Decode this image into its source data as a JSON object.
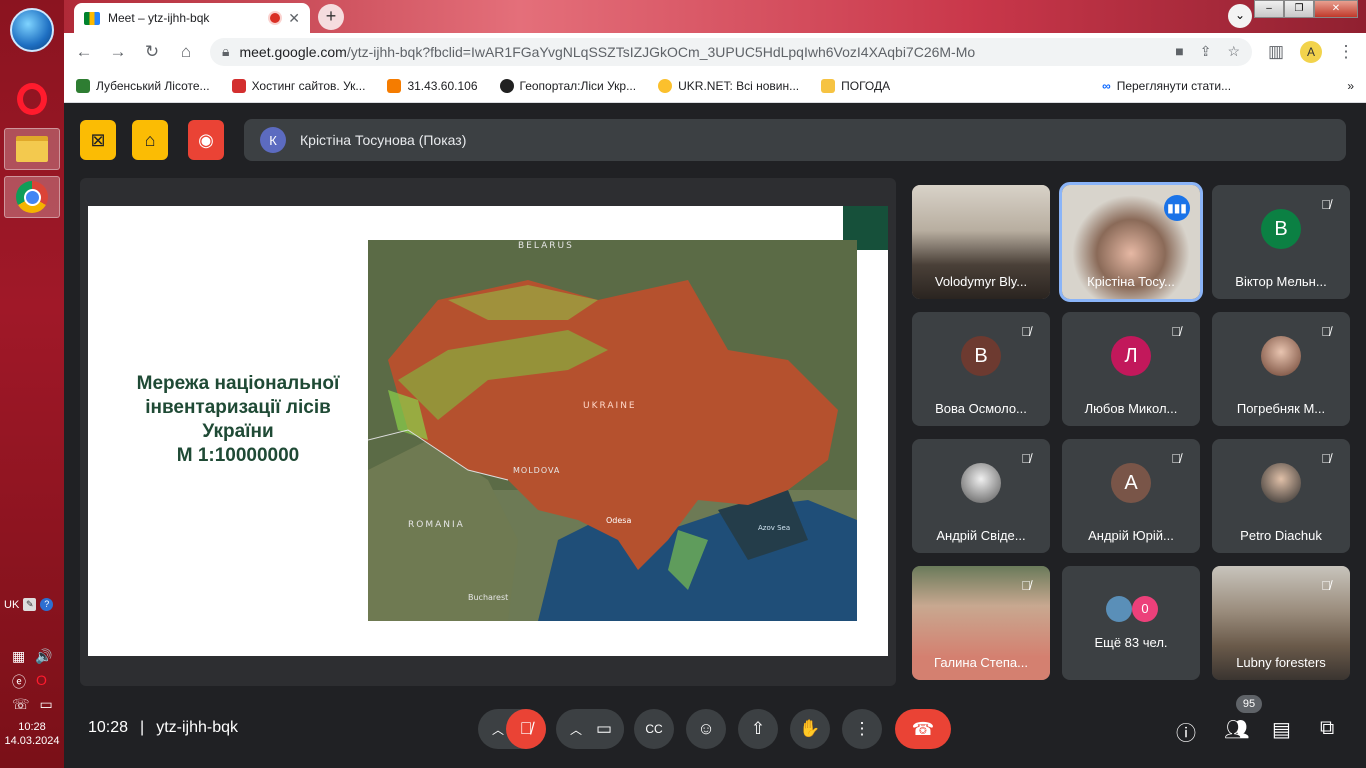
{
  "taskbar": {
    "lang": "UK",
    "time": "10:28",
    "date": "14.03.2024"
  },
  "browser": {
    "tab_title": "Meet – ytz-ijhh-bqk",
    "url_host": "meet.google.com",
    "url_path": "/ytz-ijhh-bqk?fbclid=IwAR1FGaYvgNLqSSZTsIZJGkOCm_3UPUC5HdLpqIwh6VozI4XAqbi7C26M-Mo",
    "bookmarks": [
      {
        "label": "Лубенський Лісоте...",
        "color": "#2e7d32"
      },
      {
        "label": "Хостинг сайтов. Ук...",
        "color": "#d32f2f"
      },
      {
        "label": "31.43.60.106",
        "color": "#f57c00"
      },
      {
        "label": "Геопортал:Ліси Укр...",
        "color": "#212121"
      },
      {
        "label": "UKR.NET: Всі новин...",
        "color": "#fbc02d"
      },
      {
        "label": "ПОГОДА",
        "color": "#f6c342"
      },
      {
        "label": "Переглянути стати...",
        "color": "#0866ff"
      }
    ]
  },
  "meet": {
    "presenter": {
      "initial": "К",
      "label": "Крістіна Тосунова (Показ)"
    },
    "slide": {
      "title_lines": [
        "Мережа національної",
        "інвентаризації лісів",
        "України",
        "М 1:10000000"
      ],
      "map_labels": {
        "belarus": "BELARUS",
        "ukraine": "UKRAINE",
        "moldova": "MOLDOVA",
        "romania": "ROMANIA",
        "odesa": "Odesa",
        "azov": "Azov Sea",
        "bucharest": "Bucharest"
      }
    },
    "participants": [
      {
        "name": "Volodymyr Bly...",
        "kind": "video",
        "muted": false
      },
      {
        "name": "Крістіна Тосу...",
        "kind": "video",
        "muted": false,
        "speaking": true
      },
      {
        "name": "Віктор Мельн...",
        "initial": "В",
        "avatar_color": "#0b8043",
        "muted": true
      },
      {
        "name": "Вова Осмоло...",
        "initial": "В",
        "avatar_color": "#6d3a30",
        "muted": true
      },
      {
        "name": "Любов Микол...",
        "initial": "Л",
        "avatar_color": "#c2185b",
        "muted": true
      },
      {
        "name": "Погребняк М...",
        "kind": "photo",
        "muted": true
      },
      {
        "name": "Андрій Свіде...",
        "kind": "photo",
        "muted": true
      },
      {
        "name": "Андрій Юрій...",
        "initial": "А",
        "avatar_color": "#795548",
        "muted": true
      },
      {
        "name": "Petro Diachuk",
        "kind": "photo",
        "muted": true
      },
      {
        "name": "Галина Степа...",
        "kind": "video",
        "muted": true
      },
      {
        "name": "Ещё 83 чел.",
        "kind": "more",
        "count_badge": "0"
      },
      {
        "name": "Lubny foresters",
        "kind": "video",
        "muted": true
      }
    ],
    "bottom": {
      "time": "10:28",
      "separator": "|",
      "code": "ytz-ijhh-bqk",
      "people_count": "95"
    }
  }
}
